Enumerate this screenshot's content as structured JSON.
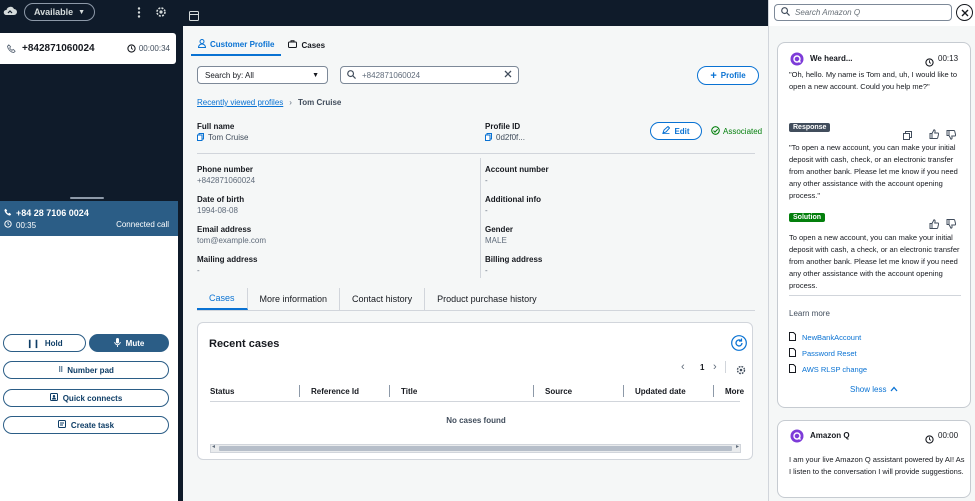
{
  "left": {
    "status": "Available",
    "call_number": "+842871060024",
    "call_timer": "00:00:34",
    "active_number": "+84 28 7106 0024",
    "active_timer": "00:35",
    "active_status": "Connected call",
    "hold_label": "Hold",
    "mute_label": "Mute",
    "numberpad_label": "Number pad",
    "quickconnects_label": "Quick connects",
    "createtask_label": "Create task"
  },
  "center": {
    "tabs": [
      "Customer Profile",
      "Cases"
    ],
    "search_by": "Search by: All",
    "search_value": "+842871060024",
    "profile_button": "Profile",
    "breadcrumb_link": "Recently viewed profiles",
    "breadcrumb_current": "Tom Cruise",
    "fullname_label": "Full name",
    "fullname_value": "Tom Cruise",
    "profileid_label": "Profile ID",
    "profileid_value": "0d2f0f...",
    "edit_label": "Edit",
    "associated_label": "Associated",
    "phone_label": "Phone number",
    "phone_value": "+842871060024",
    "account_label": "Account number",
    "account_value": "-",
    "dob_label": "Date of birth",
    "dob_value": "1994-08-08",
    "additional_label": "Additional info",
    "additional_value": "-",
    "email_label": "Email address",
    "email_value": "tom@example.com",
    "gender_label": "Gender",
    "gender_value": "MALE",
    "mailing_label": "Mailing address",
    "mailing_value": "-",
    "billing_label": "Billing address",
    "billing_value": "-",
    "subtabs": [
      "Cases",
      "More information",
      "Contact history",
      "Product purchase history"
    ],
    "recent_cases_title": "Recent cases",
    "page_number": "1",
    "columns": [
      "Status",
      "Reference Id",
      "Title",
      "Source",
      "Updated date",
      "More"
    ],
    "empty_text": "No cases found"
  },
  "right": {
    "search_placeholder": "Search Amazon Q",
    "heard_title": "We heard...",
    "heard_time": "00:13",
    "heard_text": "\"Oh, hello. My name is Tom and, uh, I would like to open a new account. Could you help me?\"",
    "response_badge": "Response",
    "response_text": "\"To open a new account, you can make your initial deposit with cash, check, or an electronic transfer from another bank. Please let me know if you need any other assistance with the account opening process.\"",
    "solution_badge": "Solution",
    "solution_text": "To open a new account, you can make your initial deposit with cash, a check, or an electronic transfer from another bank. Please let me know if you need any other assistance with the account opening process.",
    "learn_more": "Learn more",
    "links": [
      "NewBankAccount",
      "Password Reset",
      "AWS RLSP change"
    ],
    "show_less": "Show less",
    "q_title": "Amazon Q",
    "q_time": "00:00",
    "q_text": "I am your live Amazon Q assistant powered by AI! As I listen to the conversation I will provide suggestions.",
    "response_color": "#414d5c",
    "solution_color": "#037f0c",
    "q_accent": "#7d3bd8"
  }
}
